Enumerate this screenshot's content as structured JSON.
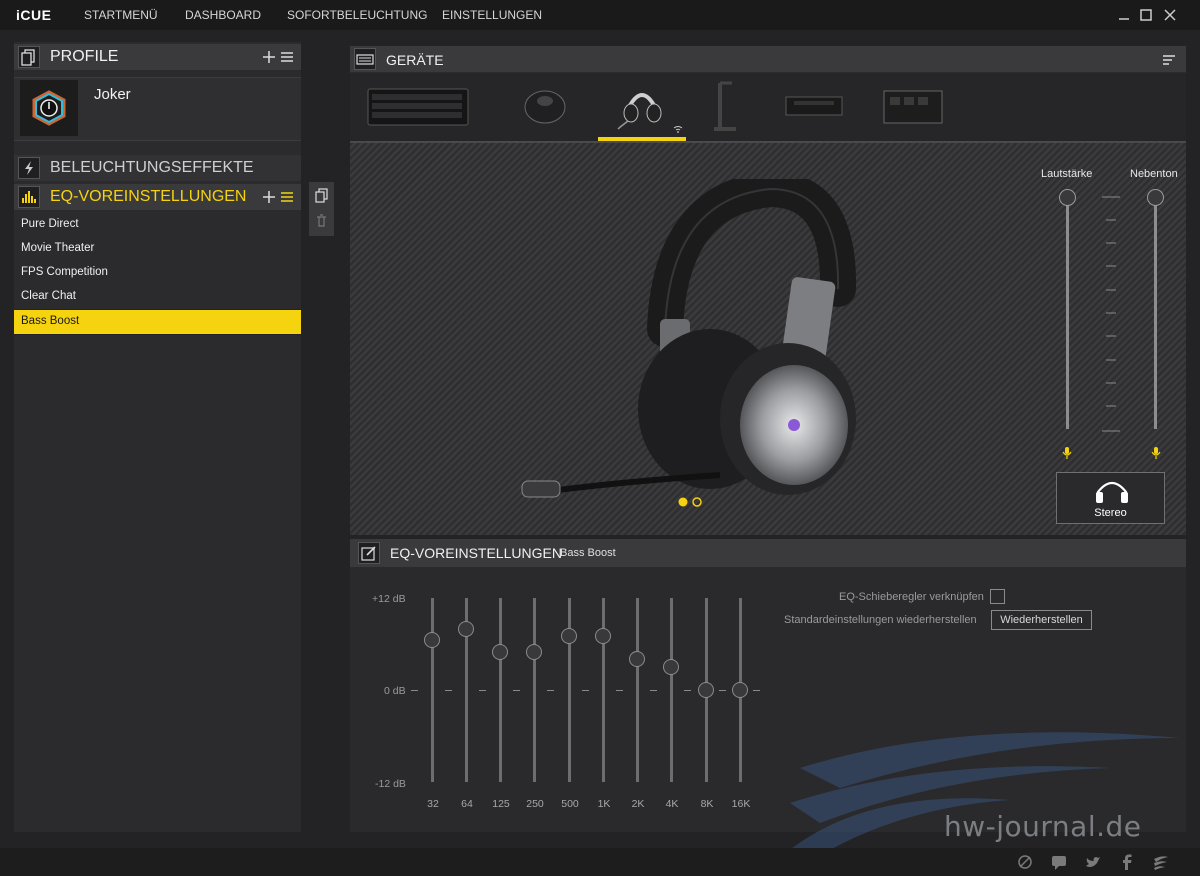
{
  "app": {
    "logo": "iCUE"
  },
  "nav": {
    "items": [
      "STARTMENÜ",
      "DASHBOARD",
      "SOFORTBELEUCHTUNG",
      "EINSTELLUNGEN"
    ]
  },
  "profiles": {
    "title": "PROFILE",
    "items": [
      {
        "name": "Joker"
      }
    ]
  },
  "lighting": {
    "title": "BELEUCHTUNGSEFFEKTE"
  },
  "eq_presets": {
    "title": "EQ-VOREINSTELLUNGEN",
    "items": [
      {
        "label": "Pure Direct"
      },
      {
        "label": "Movie Theater"
      },
      {
        "label": "FPS Competition"
      },
      {
        "label": "Clear Chat"
      },
      {
        "label": "Bass Boost",
        "selected": true
      }
    ]
  },
  "devices": {
    "title": "GERÄTE",
    "items": [
      {
        "name": "keyboard-icon"
      },
      {
        "name": "mouse-icon"
      },
      {
        "name": "headset-icon",
        "selected": true
      },
      {
        "name": "headset-stand-icon"
      },
      {
        "name": "memory-icon"
      },
      {
        "name": "controller-icon"
      }
    ]
  },
  "volume": {
    "labels": {
      "volume": "Lautstärke",
      "sidetone": "Nebenton"
    },
    "volume_level": 1.0,
    "sidetone_level": 1.0
  },
  "audio_mode": {
    "label": "Stereo"
  },
  "eq": {
    "title": "EQ-VOREINSTELLUNGEN",
    "subtitle": "Bass Boost",
    "db_labels": {
      "top": "+12 dB",
      "mid": "0 dB",
      "bottom": "-12 dB"
    },
    "bands": [
      {
        "freq": "32",
        "gain_db": 6.5
      },
      {
        "freq": "64",
        "gain_db": 8.0
      },
      {
        "freq": "125",
        "gain_db": 5.0
      },
      {
        "freq": "250",
        "gain_db": 5.0
      },
      {
        "freq": "500",
        "gain_db": 7.0
      },
      {
        "freq": "1K",
        "gain_db": 7.0
      },
      {
        "freq": "2K",
        "gain_db": 4.0
      },
      {
        "freq": "4K",
        "gain_db": 3.0
      },
      {
        "freq": "8K",
        "gain_db": 0.0
      },
      {
        "freq": "16K",
        "gain_db": 0.0
      }
    ],
    "link_label": "EQ-Schieberegler verknüpfen",
    "reset_label": "Standardeinstellungen wiederherstellen",
    "reset_button": "Wiederherstellen"
  },
  "watermark": {
    "text": "hw-journal.de"
  },
  "colors": {
    "accent": "#f5d30f"
  }
}
